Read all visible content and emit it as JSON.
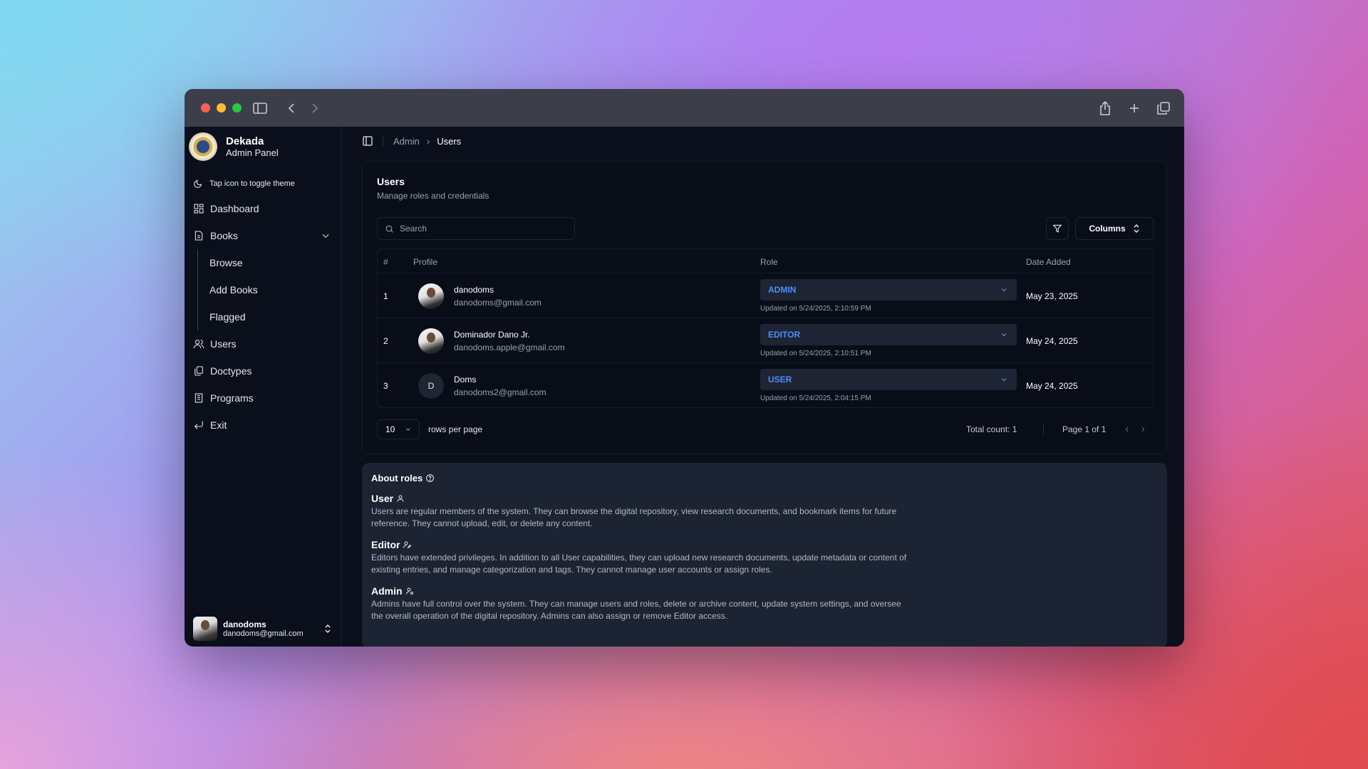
{
  "brand": {
    "name": "Dekada",
    "subtitle": "Admin Panel"
  },
  "theme_toggle": {
    "label": "Tap icon to toggle theme",
    "icon": "moon-icon"
  },
  "nav": {
    "dashboard": "Dashboard",
    "books": "Books",
    "books_sub": [
      "Browse",
      "Add Books",
      "Flagged"
    ],
    "users": "Users",
    "doctypes": "Doctypes",
    "programs": "Programs",
    "exit": "Exit"
  },
  "current_user": {
    "name": "danodoms",
    "email": "danodoms@gmail.com"
  },
  "breadcrumb": {
    "parent": "Admin",
    "current": "Users"
  },
  "users_card": {
    "title": "Users",
    "subtitle": "Manage roles and credentials",
    "search_placeholder": "Search",
    "columns_label": "Columns",
    "headers": {
      "num": "#",
      "profile": "Profile",
      "role": "Role",
      "date": "Date Added"
    },
    "rows": [
      {
        "num": "1",
        "name": "danodoms",
        "email": "danodoms@gmail.com",
        "role": "ADMIN",
        "updated": "Updated on 5/24/2025, 2:10:59 PM",
        "date": "May 23, 2025",
        "avatar": "photo"
      },
      {
        "num": "2",
        "name": "Dominador Dano Jr.",
        "email": "danodoms.apple@gmail.com",
        "role": "EDITOR",
        "updated": "Updated on 5/24/2025, 2:10:51 PM",
        "date": "May 24, 2025",
        "avatar": "photo"
      },
      {
        "num": "3",
        "name": "Doms",
        "email": "danodoms2@gmail.com",
        "role": "USER",
        "updated": "Updated on 5/24/2025, 2:04:15 PM",
        "date": "May 24, 2025",
        "avatar": "D"
      }
    ],
    "pager": {
      "rows_per_page_value": "10",
      "rows_per_page_label": "rows per page",
      "total": "Total count: 1",
      "page": "Page 1 of 1"
    }
  },
  "about_roles": {
    "title": "About roles",
    "roles": [
      {
        "name": "User",
        "desc": "Users are regular members of the system. They can browse the digital repository, view research documents, and bookmark items for future reference. They cannot upload, edit, or delete any content."
      },
      {
        "name": "Editor",
        "desc": "Editors have extended privileges. In addition to all User capabilities, they can upload new research documents, update metadata or content of existing entries, and manage categorization and tags. They cannot manage user accounts or assign roles."
      },
      {
        "name": "Admin",
        "desc": "Admins have full control over the system. They can manage users and roles, delete or archive content, update system settings, and oversee the overall operation of the digital repository. Admins can also assign or remove Editor access."
      }
    ]
  },
  "colors": {
    "accent": "#4f8ef7",
    "background": "#0a0f1b",
    "panel": "#1c2332"
  }
}
